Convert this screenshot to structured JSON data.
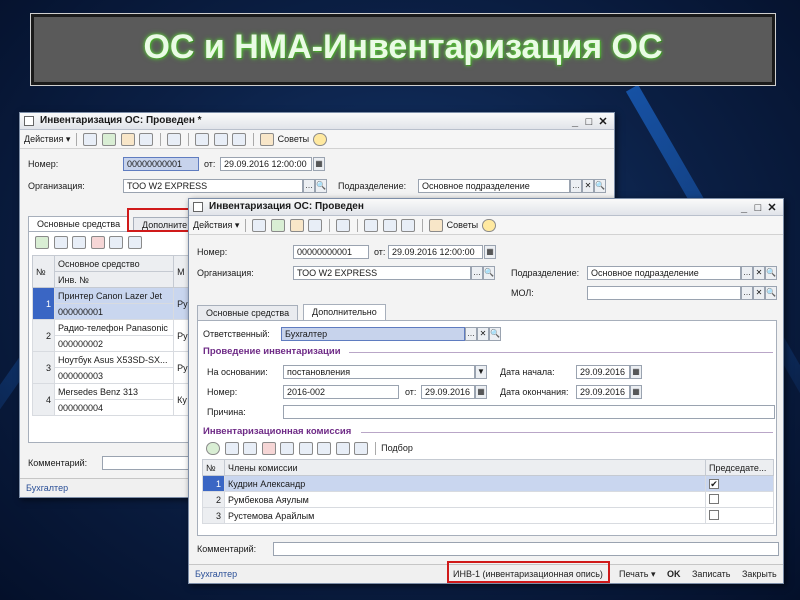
{
  "banner": {
    "title": "ОС и НМА-Инвентаризация ОС"
  },
  "back_window": {
    "title": "Инвентаризация ОС: Проведен *",
    "toolbar": {
      "actions": "Действия ▾",
      "tips": "Советы"
    },
    "number_label": "Номер:",
    "number_value": "00000000001",
    "from_label": "от:",
    "date_value": "29.09.2016 12:00:00",
    "org_label": "Организация:",
    "org_value": "ТОО W2 EXPRESS",
    "dept_label": "Подразделение:",
    "dept_value": "Основное подразделение",
    "tabs": [
      "Основные средства",
      "Дополните"
    ],
    "table": {
      "col_num": "№",
      "col_asset": "Основное средство",
      "col_inv": "Инв. №",
      "col_m": "М",
      "rows": [
        {
          "n": "1",
          "name": "Принтер Canon Lazer Jet",
          "inv": "000000001",
          "m": "Ру"
        },
        {
          "n": "2",
          "name": "Радио-телефон Panasonic",
          "inv": "000000002",
          "m": "Ру"
        },
        {
          "n": "3",
          "name": "Ноутбук Asus X53SD-SX...",
          "inv": "000000003",
          "m": "Ру"
        },
        {
          "n": "4",
          "name": "Mersedes Benz 313",
          "inv": "000000004",
          "m": "Ку"
        }
      ]
    },
    "comment_label": "Комментарий:",
    "status_user": "Бухгалтер"
  },
  "front_window": {
    "title": "Инвентаризация ОС: Проведен",
    "toolbar": {
      "actions": "Действия ▾",
      "tips": "Советы"
    },
    "number_label": "Номер:",
    "number_value": "00000000001",
    "from_label": "от:",
    "date_value": "29.09.2016 12:00:00",
    "org_label": "Организация:",
    "org_value": "ТОО W2 EXPRESS",
    "dept_label": "Подразделение:",
    "dept_value": "Основное подразделение",
    "mol_label": "МОЛ:",
    "mol_value": "",
    "tabs": [
      "Основные средства",
      "Дополнительно"
    ],
    "responsible_label": "Ответственный:",
    "responsible_value": "Бухгалтер",
    "section_inventory": "Проведение инвентаризации",
    "basis_label": "На основании:",
    "basis_value": "постановления",
    "start_label": "Дата начала:",
    "start_value": "29.09.2016",
    "number2_label": "Номер:",
    "number2_value": "2016-002",
    "from2_label": "от:",
    "date2_value": "29.09.2016",
    "end_label": "Дата окончания:",
    "end_value": "29.09.2016",
    "reason_label": "Причина:",
    "reason_value": "",
    "section_commission": "Инвентаризационная комиссия",
    "pick_label": "Подбор",
    "commission": {
      "col_num": "№",
      "col_members": "Члены комиссии",
      "col_chair": "Председате...",
      "rows": [
        {
          "n": "1",
          "name": "Кудрин Александр",
          "chair": "✔"
        },
        {
          "n": "2",
          "name": "Румбекова Аяулым",
          "chair": ""
        },
        {
          "n": "3",
          "name": "Рустемова Арайлым",
          "chair": ""
        }
      ]
    },
    "comment_label": "Комментарий:",
    "comment_value": "",
    "status_user": "Бухгалтер",
    "inv1_button": "ИНВ-1 (инвентаризационная опись)",
    "print_button": "Печать ▾",
    "ok_button": "OK",
    "save_button": "Записать",
    "close_button": "Закрыть"
  }
}
